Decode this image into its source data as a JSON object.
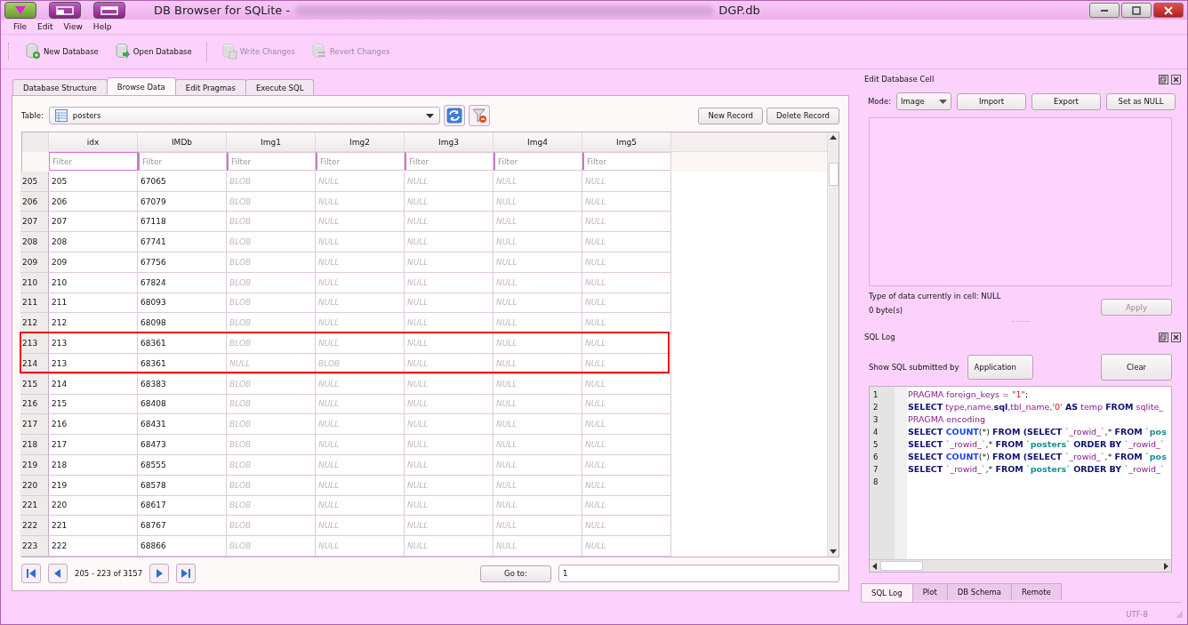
{
  "window": {
    "title": "DB Browser for SQLite -",
    "file_name": "DGP.db"
  },
  "menu": [
    {
      "label": "File"
    },
    {
      "label": "Edit"
    },
    {
      "label": "View"
    },
    {
      "label": "Help"
    }
  ],
  "toolbar": [
    {
      "label": "New Database",
      "kind": "new",
      "disabled": false
    },
    {
      "label": "Open Database",
      "kind": "open",
      "disabled": false
    },
    {
      "label": "Write Changes",
      "kind": "write",
      "disabled": true
    },
    {
      "label": "Revert Changes",
      "kind": "revert",
      "disabled": true
    }
  ],
  "tabs": [
    {
      "label": "Database Structure",
      "selected": false
    },
    {
      "label": "Browse Data",
      "selected": true
    },
    {
      "label": "Edit Pragmas",
      "selected": false
    },
    {
      "label": "Execute SQL",
      "selected": false
    }
  ],
  "browse": {
    "table_label": "Table:",
    "table_name": "posters",
    "buttons": [
      "New Record",
      "Delete Record"
    ],
    "columns": [
      "idx",
      "IMDb",
      "Img1",
      "Img2",
      "Img3",
      "Img4",
      "Img5"
    ],
    "filters": [
      {
        "placeholder": "Filter",
        "focused": true
      },
      {
        "placeholder": "Filter",
        "focused": false
      },
      {
        "placeholder": "Filter",
        "focused": false
      },
      {
        "placeholder": "Filter",
        "focused": false
      },
      {
        "placeholder": "Filter",
        "focused": false
      },
      {
        "placeholder": "Filter",
        "focused": false
      },
      {
        "placeholder": "Filter",
        "focused": false
      }
    ],
    "rows": [
      {
        "header": "205",
        "cells": [
          "205",
          "67065",
          "BLOB",
          "NULL",
          "NULL",
          "NULL",
          "NULL"
        ],
        "marked": false
      },
      {
        "header": "206",
        "cells": [
          "206",
          "67079",
          "BLOB",
          "NULL",
          "NULL",
          "NULL",
          "NULL"
        ],
        "marked": false
      },
      {
        "header": "207",
        "cells": [
          "207",
          "67118",
          "BLOB",
          "NULL",
          "NULL",
          "NULL",
          "NULL"
        ],
        "marked": false
      },
      {
        "header": "208",
        "cells": [
          "208",
          "67741",
          "BLOB",
          "NULL",
          "NULL",
          "NULL",
          "NULL"
        ],
        "marked": false
      },
      {
        "header": "209",
        "cells": [
          "209",
          "67756",
          "BLOB",
          "NULL",
          "NULL",
          "NULL",
          "NULL"
        ],
        "marked": false
      },
      {
        "header": "210",
        "cells": [
          "210",
          "67824",
          "BLOB",
          "NULL",
          "NULL",
          "NULL",
          "NULL"
        ],
        "marked": false
      },
      {
        "header": "211",
        "cells": [
          "211",
          "68093",
          "BLOB",
          "NULL",
          "NULL",
          "NULL",
          "NULL"
        ],
        "marked": false
      },
      {
        "header": "212",
        "cells": [
          "212",
          "68098",
          "BLOB",
          "NULL",
          "NULL",
          "NULL",
          "NULL"
        ],
        "marked": false
      },
      {
        "header": "213",
        "cells": [
          "213",
          "68361",
          "BLOB",
          "NULL",
          "NULL",
          "NULL",
          "NULL"
        ],
        "marked": true
      },
      {
        "header": "214",
        "cells": [
          "213",
          "68361",
          "NULL",
          "BLOB",
          "NULL",
          "NULL",
          "NULL"
        ],
        "marked": true
      },
      {
        "header": "215",
        "cells": [
          "214",
          "68383",
          "BLOB",
          "NULL",
          "NULL",
          "NULL",
          "NULL"
        ],
        "marked": false
      },
      {
        "header": "216",
        "cells": [
          "215",
          "68408",
          "BLOB",
          "NULL",
          "NULL",
          "NULL",
          "NULL"
        ],
        "marked": false
      },
      {
        "header": "217",
        "cells": [
          "216",
          "68431",
          "BLOB",
          "NULL",
          "NULL",
          "NULL",
          "NULL"
        ],
        "marked": false
      },
      {
        "header": "218",
        "cells": [
          "217",
          "68473",
          "BLOB",
          "NULL",
          "NULL",
          "NULL",
          "NULL"
        ],
        "marked": false
      },
      {
        "header": "219",
        "cells": [
          "218",
          "68555",
          "BLOB",
          "NULL",
          "NULL",
          "NULL",
          "NULL"
        ],
        "marked": false
      },
      {
        "header": "220",
        "cells": [
          "219",
          "68578",
          "BLOB",
          "NULL",
          "NULL",
          "NULL",
          "NULL"
        ],
        "marked": false
      },
      {
        "header": "221",
        "cells": [
          "220",
          "68617",
          "BLOB",
          "NULL",
          "NULL",
          "NULL",
          "NULL"
        ],
        "marked": false
      },
      {
        "header": "222",
        "cells": [
          "221",
          "68767",
          "BLOB",
          "NULL",
          "NULL",
          "NULL",
          "NULL"
        ],
        "marked": false
      },
      {
        "header": "223",
        "cells": [
          "222",
          "68866",
          "BLOB",
          "NULL",
          "NULL",
          "NULL",
          "NULL"
        ],
        "marked": false
      }
    ],
    "range": "205 - 223 of 3157",
    "goto_label": "Go to:",
    "goto_value": "1"
  },
  "edit_cell": {
    "title": "Edit Database Cell",
    "mode_label": "Mode:",
    "mode": "Image",
    "buttons": [
      {
        "label": "Import",
        "disabled": false
      },
      {
        "label": "Export",
        "disabled": false
      },
      {
        "label": "Set as NULL",
        "disabled": false
      }
    ],
    "type_info": "Type of data currently in cell: NULL",
    "size_info": "0 byte(s)",
    "apply": {
      "label": "Apply",
      "disabled": true
    }
  },
  "sql_log": {
    "title": "SQL Log",
    "show_label": "Show SQL submitted by",
    "source": "Application",
    "clear": {
      "label": "Clear"
    },
    "lines": [
      {
        "number": "1",
        "tokens": [
          {
            "text": "PRAGMA foreign_keys = ",
            "kind": "ident"
          },
          {
            "text": "\"1\"",
            "kind": "string"
          },
          {
            "text": ";",
            "kind": "punct"
          }
        ]
      },
      {
        "number": "2",
        "tokens": [
          {
            "text": "SELECT",
            "kind": "keyword"
          },
          {
            "text": " type,name,",
            "kind": "ident"
          },
          {
            "text": "sql",
            "kind": "keyword"
          },
          {
            "text": ",tbl_name,",
            "kind": "ident"
          },
          {
            "text": "'0'",
            "kind": "string"
          },
          {
            "text": " AS",
            "kind": "keyword"
          },
          {
            "text": " temp ",
            "kind": "ident"
          },
          {
            "text": "FROM",
            "kind": "keyword"
          },
          {
            "text": " sqlite_",
            "kind": "ident"
          }
        ]
      },
      {
        "number": "3",
        "tokens": [
          {
            "text": "PRAGMA encoding",
            "kind": "ident"
          }
        ]
      },
      {
        "number": "4",
        "tokens": [
          {
            "text": "SELECT ",
            "kind": "keyword"
          },
          {
            "text": "COUNT",
            "kind": "function"
          },
          {
            "text": "(*) ",
            "kind": "punct"
          },
          {
            "text": "FROM (SELECT ",
            "kind": "keyword"
          },
          {
            "text": "`_rowid_`",
            "kind": "ident"
          },
          {
            "text": ",* ",
            "kind": "punct"
          },
          {
            "text": "FROM ",
            "kind": "keyword"
          },
          {
            "text": "`pos",
            "kind": "table"
          }
        ]
      },
      {
        "number": "5",
        "tokens": [
          {
            "text": "SELECT ",
            "kind": "keyword"
          },
          {
            "text": "`_rowid_`",
            "kind": "ident"
          },
          {
            "text": ",* ",
            "kind": "punct"
          },
          {
            "text": "FROM ",
            "kind": "keyword"
          },
          {
            "text": "`posters`",
            "kind": "table"
          },
          {
            "text": " ORDER BY ",
            "kind": "keyword"
          },
          {
            "text": "`_rowid_`",
            "kind": "ident"
          }
        ]
      },
      {
        "number": "6",
        "tokens": [
          {
            "text": "SELECT ",
            "kind": "keyword"
          },
          {
            "text": "COUNT",
            "kind": "function"
          },
          {
            "text": "(*) ",
            "kind": "punct"
          },
          {
            "text": "FROM (SELECT ",
            "kind": "keyword"
          },
          {
            "text": "`_rowid_`",
            "kind": "ident"
          },
          {
            "text": ",* ",
            "kind": "punct"
          },
          {
            "text": "FROM ",
            "kind": "keyword"
          },
          {
            "text": "`pos",
            "kind": "table"
          }
        ]
      },
      {
        "number": "7",
        "tokens": [
          {
            "text": "SELECT ",
            "kind": "keyword"
          },
          {
            "text": "`_rowid_`",
            "kind": "ident"
          },
          {
            "text": ",* ",
            "kind": "punct"
          },
          {
            "text": "FROM ",
            "kind": "keyword"
          },
          {
            "text": "`posters`",
            "kind": "table"
          },
          {
            "text": " ORDER BY ",
            "kind": "keyword"
          },
          {
            "text": "`_rowid_`",
            "kind": "ident"
          }
        ]
      },
      {
        "number": "8"
      }
    ]
  },
  "dock_tabs": [
    {
      "label": "SQL Log",
      "selected": true
    },
    {
      "label": "Plot",
      "selected": false
    },
    {
      "label": "DB Schema",
      "selected": false
    },
    {
      "label": "Remote",
      "selected": false
    }
  ],
  "status_bar": {
    "encoding": "UTF-8"
  }
}
